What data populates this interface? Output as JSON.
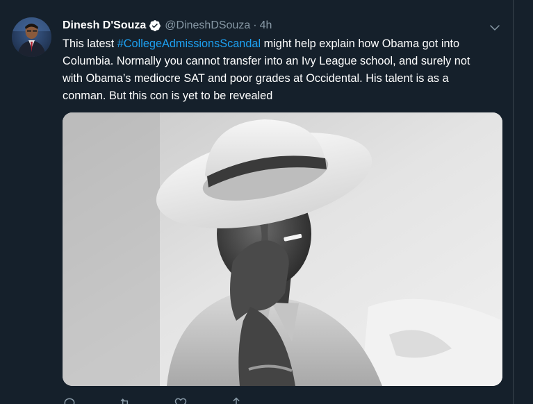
{
  "tweet": {
    "author_name": "Dinesh D'Souza",
    "handle": "@DineshDSouza",
    "separator": "·",
    "time": "4h",
    "text_lines": {
      "l1_before": "This latest ",
      "l1_hashtag": "#CollegeAdmissionsScandal",
      "l1_after": " might help explain how Obama got into",
      "l2": "Columbia. Normally you cannot transfer into an Ivy League school, and surely not",
      "l3": "with Obama’s mediocre SAT and poor grades at Occidental. His talent is as a",
      "l4": "conman. But this con is yet to be revealed"
    }
  },
  "icons": {
    "verified": "verified-badge-icon",
    "caret": "chevron-down-icon",
    "reply": "reply-icon",
    "retweet": "retweet-icon",
    "like": "heart-icon",
    "share": "share-icon"
  },
  "colors": {
    "background": "#15202b",
    "text": "#ffffff",
    "secondary": "#8899a6",
    "link": "#1da1f2",
    "divider": "#38444d"
  }
}
